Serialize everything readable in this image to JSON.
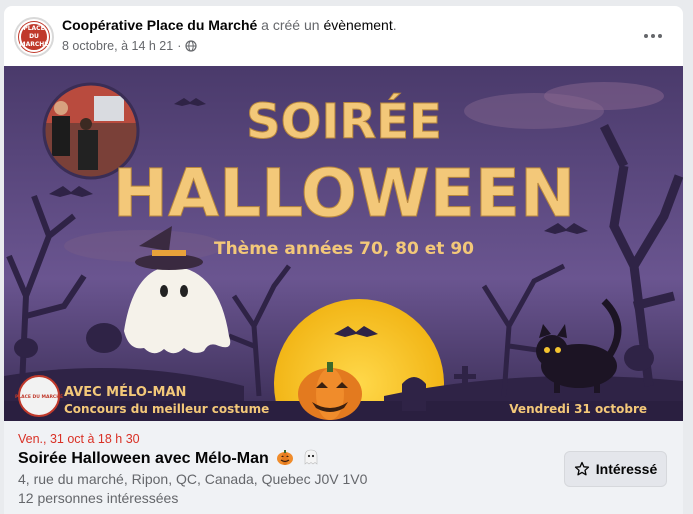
{
  "post": {
    "page_name": "Coopérative Place du Marché",
    "action_text": " a créé un ",
    "action_object": "évènement",
    "action_period": ".",
    "timestamp": "8 octobre, à 14 h 21",
    "separator": "·",
    "privacy_icon": "globe-icon",
    "more_icon": "more-horizontal-icon",
    "avatar_text": "PLACE DU MARCHÉ"
  },
  "banner": {
    "line1": "SOIRÉE",
    "line2": "HALLOWEEN",
    "theme": "Thème années 70, 80 et 90",
    "host": "AVEC MÉLO-MAN",
    "contest": "Concours du meilleur costume",
    "date": "Vendredi 31 octobre",
    "logo_text": "PLACE DU MARCHÉ",
    "colors": {
      "sky": "#5b4a7e",
      "title": "#f3c879",
      "moon": "#f4c430",
      "silhouette": "#2f2346"
    }
  },
  "event": {
    "date": "Ven., 31 oct à 18 h 30",
    "title": "Soirée Halloween avec Mélo-Man",
    "title_emojis": [
      "pumpkin-emoji",
      "ghost-emoji"
    ],
    "address": "4, rue du marché, Ripon, QC, Canada, Quebec J0V 1V0",
    "interested_count": "12 personnes intéressées",
    "button_label": "Intéressé",
    "button_icon": "star-icon",
    "date_color": "#d93025"
  }
}
